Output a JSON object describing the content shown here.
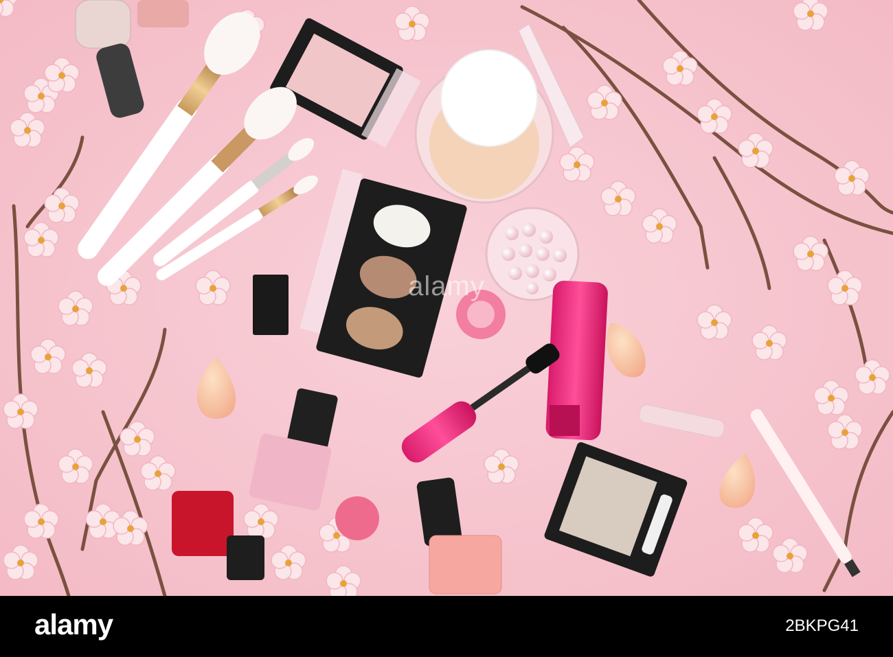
{
  "watermark": {
    "text": "alamy"
  },
  "footer": {
    "logo": "alamy",
    "image_id": "2BKPG41"
  },
  "colors": {
    "background_pink": "#f7c6cf",
    "accent_magenta": "#e8287a",
    "blossom": "#fbe3e6",
    "footer_bg": "#000000",
    "footer_text": "#ffffff"
  }
}
